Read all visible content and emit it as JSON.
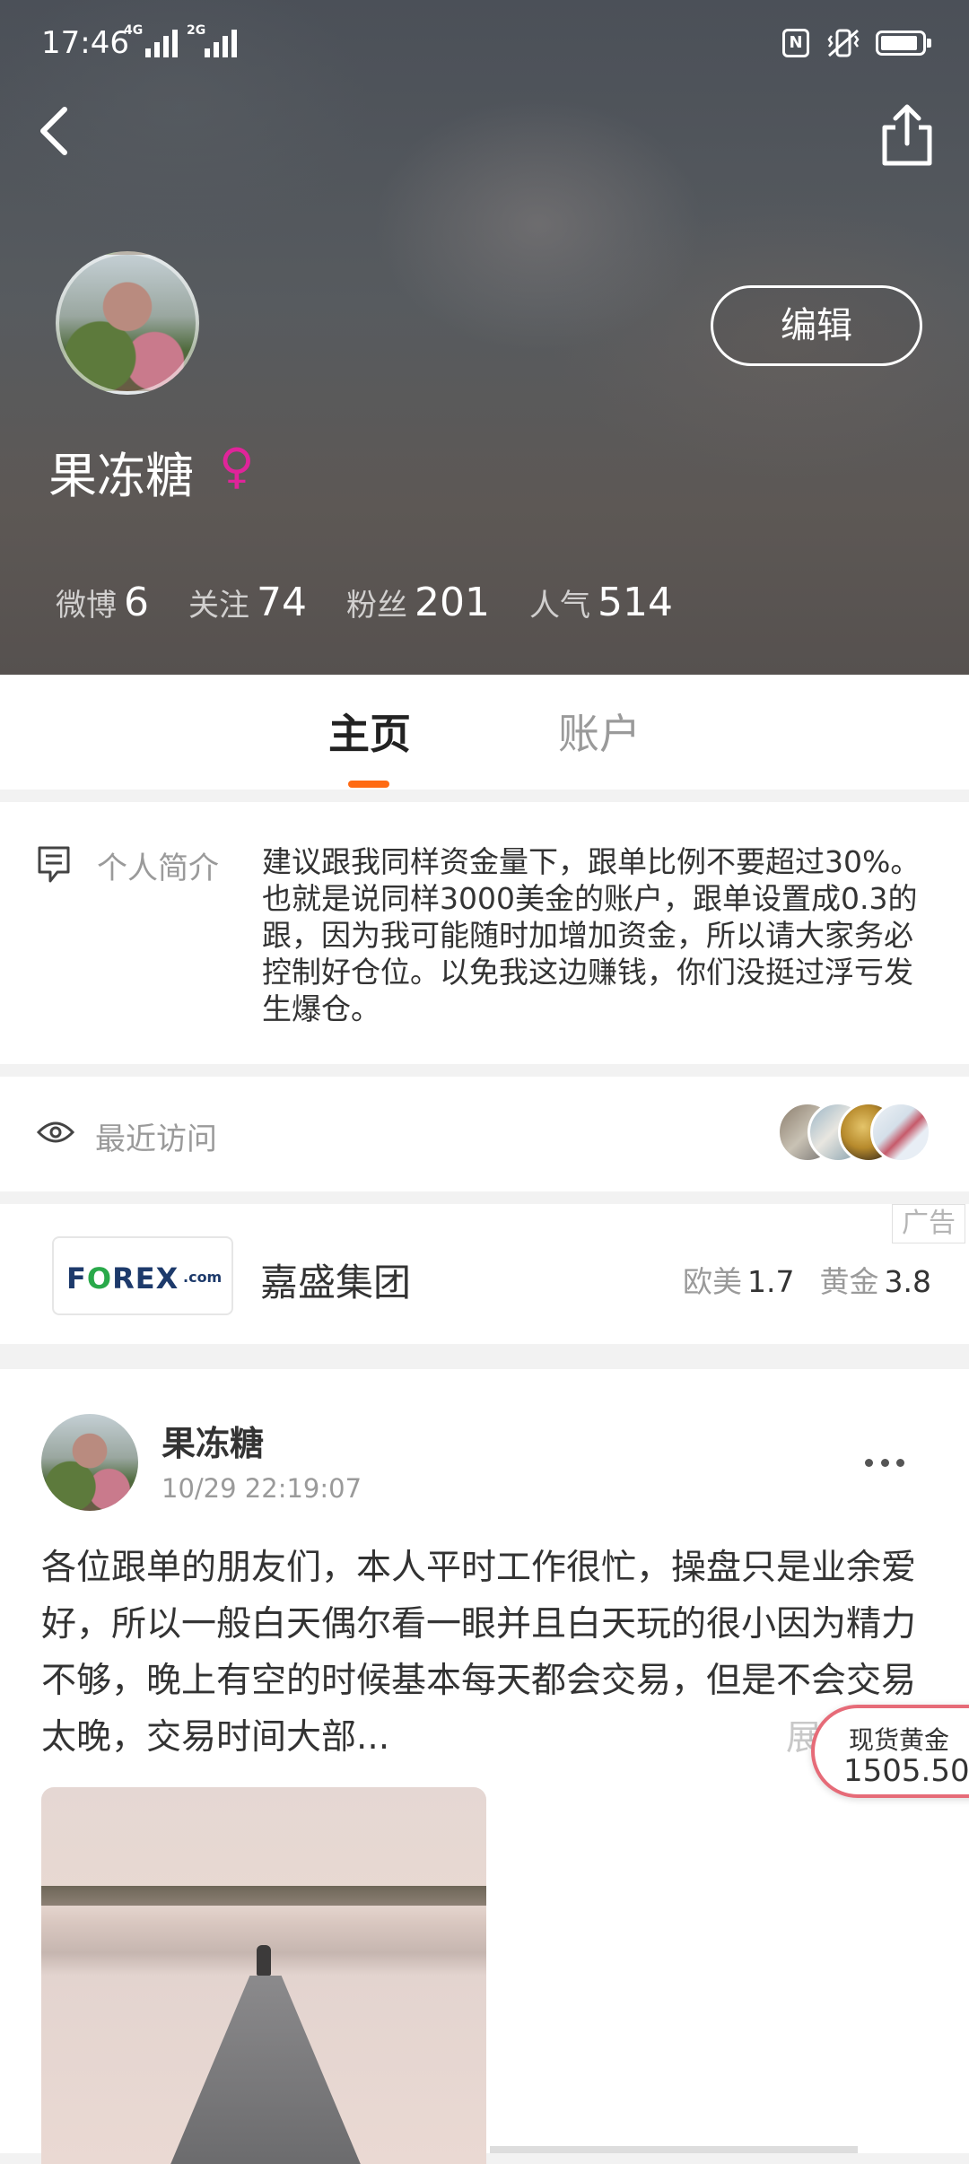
{
  "status_bar": {
    "time": "17:46",
    "network_1": "4G",
    "network_2": "2G"
  },
  "profile": {
    "username": "果冻糖",
    "gender_symbol": "♀",
    "edit_label": "编辑",
    "stats": [
      {
        "label": "微博",
        "value": "6"
      },
      {
        "label": "关注",
        "value": "74"
      },
      {
        "label": "粉丝",
        "value": "201"
      },
      {
        "label": "人气",
        "value": "514"
      }
    ]
  },
  "tabs": [
    {
      "label": "主页",
      "active": true
    },
    {
      "label": "账户",
      "active": false
    }
  ],
  "bio": {
    "label": "个人简介",
    "text": "建议跟我同样资金量下，跟单比例不要超过30%。也就是说同样3000美金的账户，跟单设置成0.3的跟，因为我可能随时加增加资金，所以请大家务必控制好仓位。以免我这边赚钱，你们没挺过浮亏发生爆仓。"
  },
  "recent_visits": {
    "label": "最近访问",
    "visitor_count": 4
  },
  "ad": {
    "tag": "广告",
    "logo_text_pre": "F",
    "logo_text_mid": "O",
    "logo_text_post": "REX",
    "logo_suffix": ".com",
    "name": "嘉盛集团",
    "rates": [
      {
        "label": "欧美",
        "value": "1.7"
      },
      {
        "label": "黄金",
        "value": "3.8"
      }
    ]
  },
  "post": {
    "author": "果冻糖",
    "time": "10/29 22:19:07",
    "text": "各位跟单的朋友们，本人平时工作很忙，操盘只是业余爱好，所以一般白天偶尔看一眼并且白天玩的很小因为精力不够，晚上有空的时候基本每天都会交易，但是不会交易太晚，交易时间大部...",
    "expand_label": "展开"
  },
  "gold_widget": {
    "label": "现货黄金",
    "price": "1505.50"
  },
  "colors": {
    "accent": "#ff6a13",
    "gender": "#e0249a",
    "widget_border": "#e66b78"
  }
}
